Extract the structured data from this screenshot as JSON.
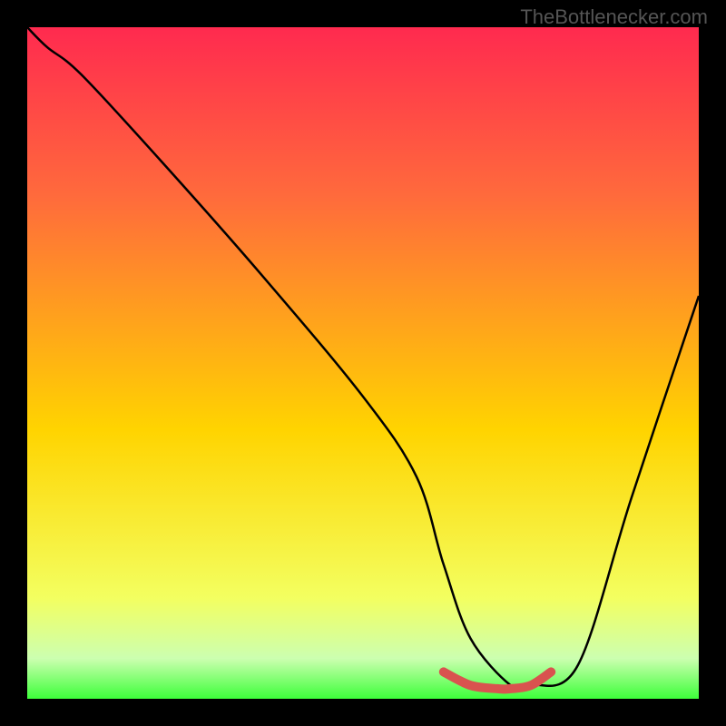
{
  "watermark": "TheBottlenecker.com",
  "chart_data": {
    "type": "line",
    "title": "",
    "xlabel": "",
    "ylabel": "",
    "xlim": [
      0,
      100
    ],
    "ylim": [
      0,
      100
    ],
    "gradient_background": {
      "top": "#ff2a4f",
      "mid": "#ffd400",
      "bottom": "#3dff3a"
    },
    "series": [
      {
        "name": "main-curve",
        "color": "#000000",
        "x": [
          0,
          3,
          8,
          20,
          35,
          50,
          58,
          62,
          66,
          72,
          75,
          82,
          90,
          100
        ],
        "values": [
          100,
          97,
          93,
          80,
          63,
          45,
          33,
          20,
          9,
          2,
          2,
          5,
          30,
          60
        ]
      },
      {
        "name": "highlight-segment",
        "color": "#d9534f",
        "x": [
          62,
          66,
          70,
          72,
          75,
          78
        ],
        "values": [
          4,
          2,
          1.5,
          1.5,
          2,
          4
        ]
      }
    ]
  }
}
